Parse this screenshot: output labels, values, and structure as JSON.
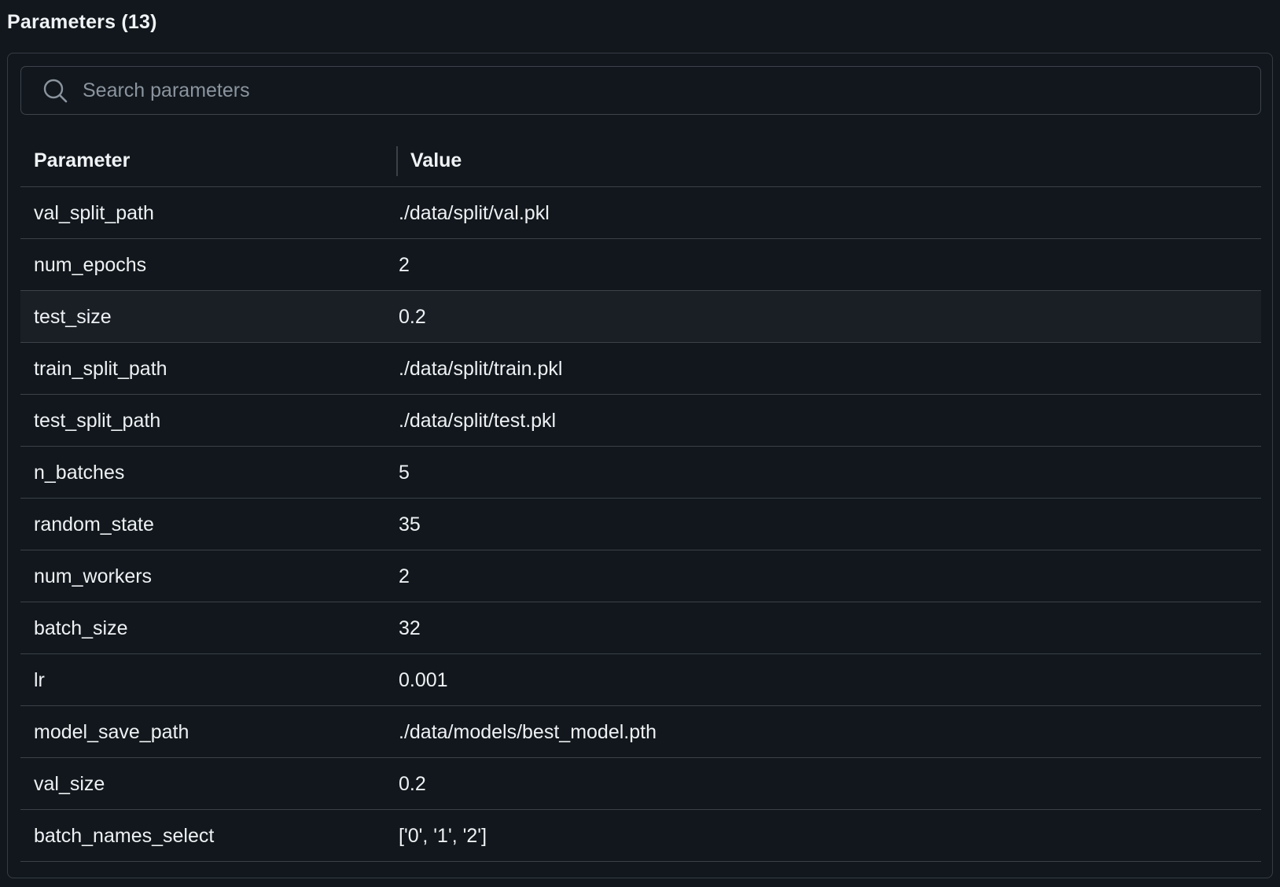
{
  "header": {
    "title": "Parameters (13)"
  },
  "search": {
    "placeholder": "Search parameters",
    "value": ""
  },
  "table": {
    "columns": [
      "Parameter",
      "Value"
    ],
    "rows": [
      {
        "name": "val_split_path",
        "value": "./data/split/val.pkl"
      },
      {
        "name": "num_epochs",
        "value": "2"
      },
      {
        "name": "test_size",
        "value": "0.2",
        "hovered": true
      },
      {
        "name": "train_split_path",
        "value": "./data/split/train.pkl"
      },
      {
        "name": "test_split_path",
        "value": "./data/split/test.pkl"
      },
      {
        "name": "n_batches",
        "value": "5"
      },
      {
        "name": "random_state",
        "value": "35"
      },
      {
        "name": "num_workers",
        "value": "2"
      },
      {
        "name": "batch_size",
        "value": "32"
      },
      {
        "name": "lr",
        "value": "0.001"
      },
      {
        "name": "model_save_path",
        "value": "./data/models/best_model.pth"
      },
      {
        "name": "val_size",
        "value": "0.2"
      },
      {
        "name": "batch_names_select",
        "value": "['0', '1', '2']"
      }
    ]
  },
  "colors": {
    "background": "#11171c",
    "border": "#3a4149",
    "hover_row": "#1a1f26",
    "placeholder": "#8b949e"
  },
  "icons": {
    "search": "search-icon"
  }
}
